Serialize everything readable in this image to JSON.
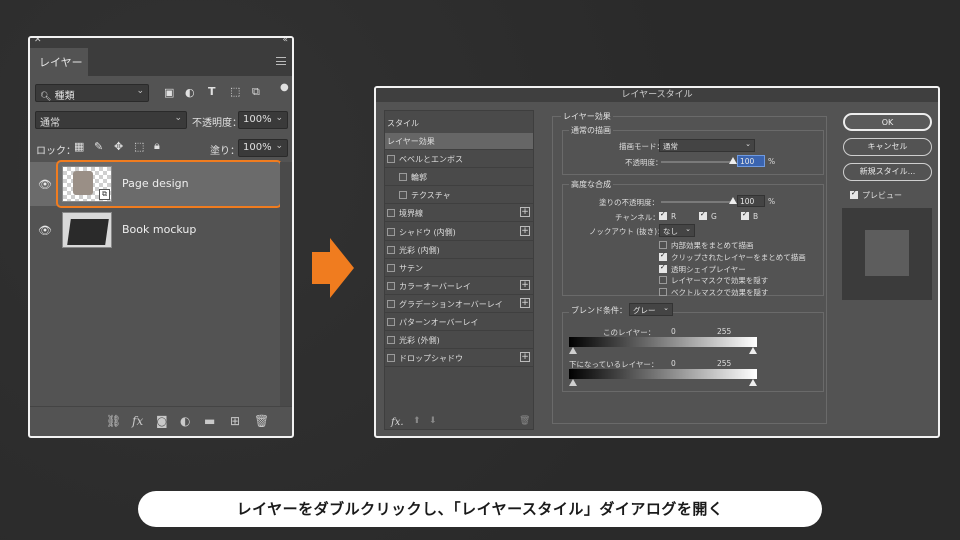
{
  "layers_panel": {
    "tab_label": "レイヤー",
    "filter": {
      "value": "種類"
    },
    "blend_mode": "通常",
    "opacity_label": "不透明度：",
    "opacity_value": "100%",
    "lock_label": "ロック：",
    "fill_label": "塗り：",
    "fill_value": "100%",
    "layers": [
      {
        "name": "Page design",
        "selected": true
      },
      {
        "name": "Book mockup",
        "selected": false
      }
    ],
    "highlight_color": "#f07c1f"
  },
  "dialog": {
    "title": "レイヤースタイル",
    "styles_header": "スタイル",
    "styles": [
      {
        "label": "レイヤー効果",
        "checkbox": false,
        "plus": false,
        "indent": false,
        "active": true
      },
      {
        "label": "ベベルとエンボス",
        "checkbox": true,
        "plus": false,
        "indent": false
      },
      {
        "label": "輪郭",
        "checkbox": true,
        "plus": false,
        "indent": true
      },
      {
        "label": "テクスチャ",
        "checkbox": true,
        "plus": false,
        "indent": true
      },
      {
        "label": "境界線",
        "checkbox": true,
        "plus": true,
        "indent": false
      },
      {
        "label": "シャドウ (内側)",
        "checkbox": true,
        "plus": true,
        "indent": false
      },
      {
        "label": "光彩 (内側)",
        "checkbox": true,
        "plus": false,
        "indent": false
      },
      {
        "label": "サテン",
        "checkbox": true,
        "plus": false,
        "indent": false
      },
      {
        "label": "カラーオーバーレイ",
        "checkbox": true,
        "plus": true,
        "indent": false
      },
      {
        "label": "グラデーションオーバーレイ",
        "checkbox": true,
        "plus": true,
        "indent": false
      },
      {
        "label": "パターンオーバーレイ",
        "checkbox": true,
        "plus": false,
        "indent": false
      },
      {
        "label": "光彩 (外側)",
        "checkbox": true,
        "plus": false,
        "indent": false
      },
      {
        "label": "ドロップシャドウ",
        "checkbox": true,
        "plus": true,
        "indent": false
      }
    ],
    "fx_label": "fx.",
    "layer_effects_title": "レイヤー効果",
    "general_blending": {
      "title": "通常の描画",
      "blend_mode_label": "描画モード：",
      "blend_mode_value": "通常",
      "opacity_label": "不透明度：",
      "opacity_value": "100",
      "opacity_percent": 100,
      "percent": "%"
    },
    "advanced_blending": {
      "title": "高度な合成",
      "fill_opacity_label": "塗りの不透明度：",
      "fill_opacity_value": "100",
      "fill_percent": 100,
      "percent": "%",
      "channels_label": "チャンネル：",
      "channels": [
        "R",
        "G",
        "B"
      ],
      "knockout_label": "ノックアウト (抜き)：",
      "knockout_value": "なし",
      "options": [
        {
          "label": "内部効果をまとめて描画",
          "checked": false
        },
        {
          "label": "クリップされたレイヤーをまとめて描画",
          "checked": true
        },
        {
          "label": "透明シェイプレイヤー",
          "checked": true
        },
        {
          "label": "レイヤーマスクで効果を隠す",
          "checked": false
        },
        {
          "label": "ベクトルマスクで効果を隠す",
          "checked": false
        }
      ]
    },
    "blend_if": {
      "label": "ブレンド条件：",
      "value": "グレー",
      "this_layer_label": "このレイヤー：",
      "underlying_label": "下になっているレイヤー：",
      "min": "0",
      "max": "255"
    },
    "buttons": {
      "ok": "OK",
      "cancel": "キャンセル",
      "new_style": "新規スタイル...",
      "preview": "プレビュー"
    }
  },
  "caption": "レイヤーをダブルクリックし、「レイヤースタイル」ダイアログを開く",
  "arrow_color": "#f07c1f"
}
